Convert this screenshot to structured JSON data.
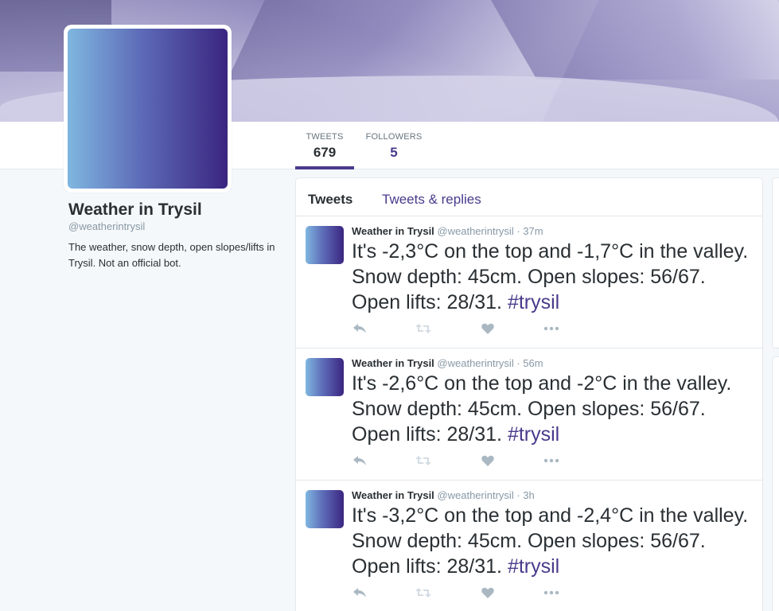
{
  "profile": {
    "name": "Weather in Trysil",
    "handle": "@weatherintrysil",
    "bio": "The weather, snow depth, open slopes/lifts in Trysil. Not an official bot."
  },
  "nav": {
    "tweets_label": "TWEETS",
    "tweets_count": "679",
    "followers_label": "FOLLOWERS",
    "followers_count": "5"
  },
  "timeline": {
    "tabs": [
      {
        "label": "Tweets",
        "active": true
      },
      {
        "label": "Tweets & replies",
        "active": false
      }
    ],
    "tweets": [
      {
        "name": "Weather in Trysil",
        "handle": "@weatherintrysil",
        "separator": " · ",
        "time": "37m",
        "text": "It's -2,3°C on the top and -1,7°C in the valley. Snow depth: 45cm. Open slopes: 56/67. Open lifts: 28/31. ",
        "hashtag": "#trysil"
      },
      {
        "name": "Weather in Trysil",
        "handle": "@weatherintrysil",
        "separator": " · ",
        "time": "56m",
        "text": "It's -2,6°C on the top and -2°C in the valley. Snow depth: 45cm. Open slopes: 56/67. Open lifts: 28/31. ",
        "hashtag": "#trysil"
      },
      {
        "name": "Weather in Trysil",
        "handle": "@weatherintrysil",
        "separator": " · ",
        "time": "3h",
        "text": "It's -3,2°C on the top and -2,4°C in the valley. Snow depth: 45cm. Open slopes: 56/67. Open lifts: 28/31. ",
        "hashtag": "#trysil"
      }
    ]
  },
  "icons": {
    "reply": "reply-icon",
    "retweet": "retweet-icon",
    "like": "heart-icon",
    "more": "more-icon"
  },
  "colors": {
    "accent": "#4a3a8c",
    "muted": "#8899a6",
    "icon": "#ccd6dd"
  }
}
